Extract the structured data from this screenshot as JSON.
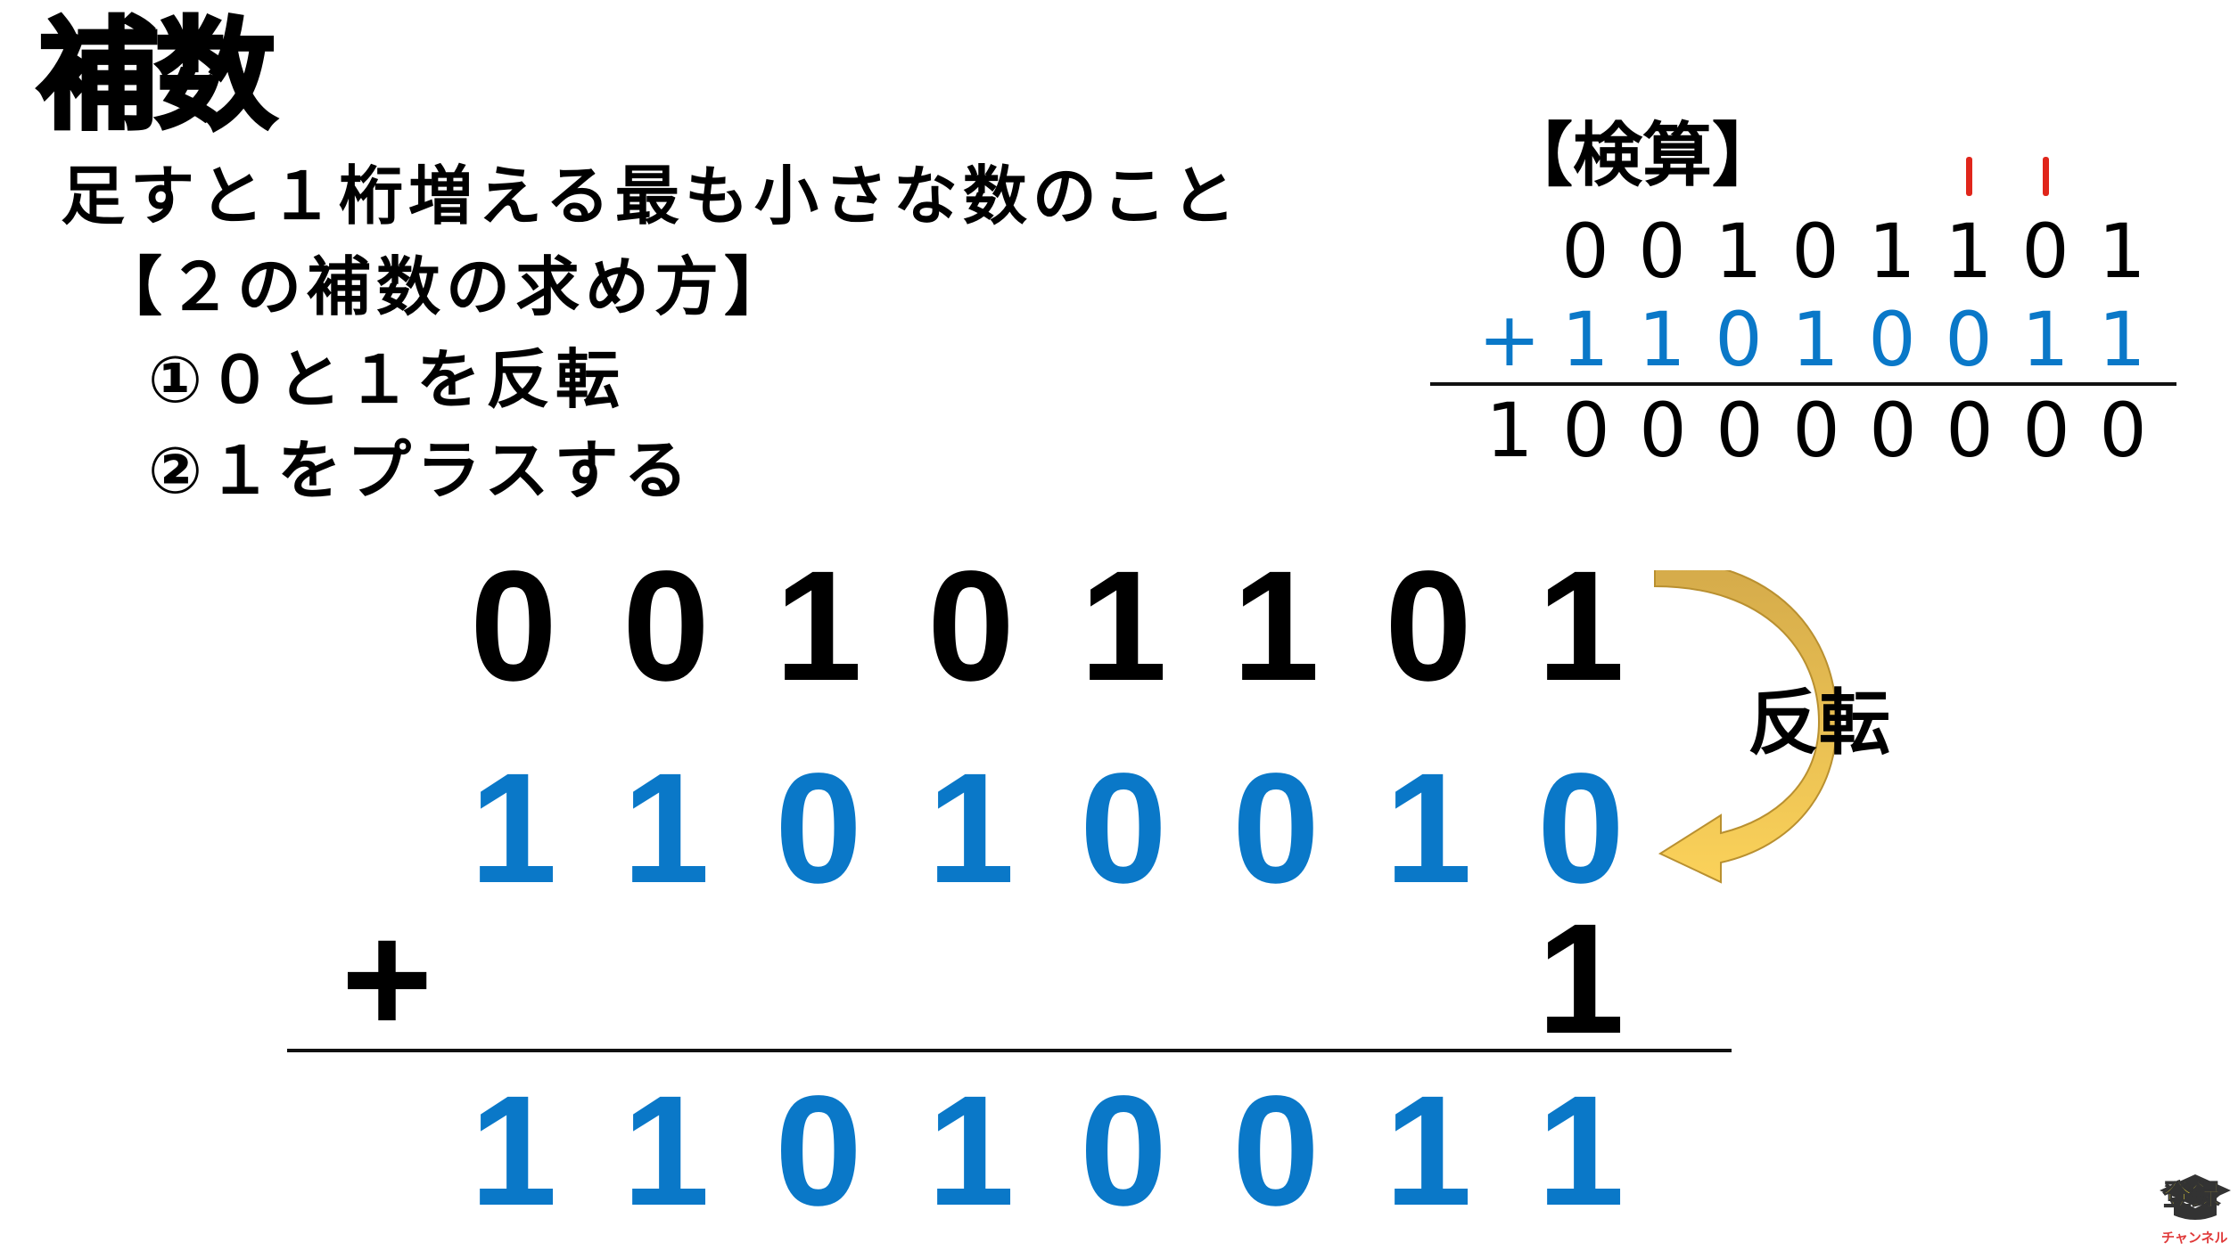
{
  "title": "補数",
  "definition": "足すと１桁増える最も小さな数のこと",
  "method_heading": "【２の補数の求め方】",
  "steps": [
    "①０と１を反転",
    "②１をプラスする"
  ],
  "main": {
    "original": [
      "0",
      "0",
      "1",
      "0",
      "1",
      "1",
      "0",
      "1"
    ],
    "inverted": [
      "1",
      "1",
      "0",
      "1",
      "0",
      "0",
      "1",
      "0"
    ],
    "plus_sign": "+",
    "addend": "1",
    "result": [
      "1",
      "1",
      "0",
      "1",
      "0",
      "0",
      "1",
      "1"
    ],
    "arrow_label": "反転"
  },
  "check": {
    "heading": "【検算】",
    "carry_columns": [
      6,
      7
    ],
    "top": [
      "0",
      "0",
      "1",
      "0",
      "1",
      "1",
      "0",
      "1"
    ],
    "plus_sign": "+",
    "bottom": [
      "1",
      "1",
      "0",
      "1",
      "0",
      "0",
      "1",
      "1"
    ],
    "sum": [
      "1",
      "0",
      "0",
      "0",
      "0",
      "0",
      "0",
      "0",
      "0"
    ]
  },
  "logo": {
    "text": "登録",
    "subtext": "チャンネル"
  },
  "colors": {
    "blue": "#0a78c8",
    "carry_red": "#e0261b",
    "arrow_gold": "#f0c24a"
  }
}
